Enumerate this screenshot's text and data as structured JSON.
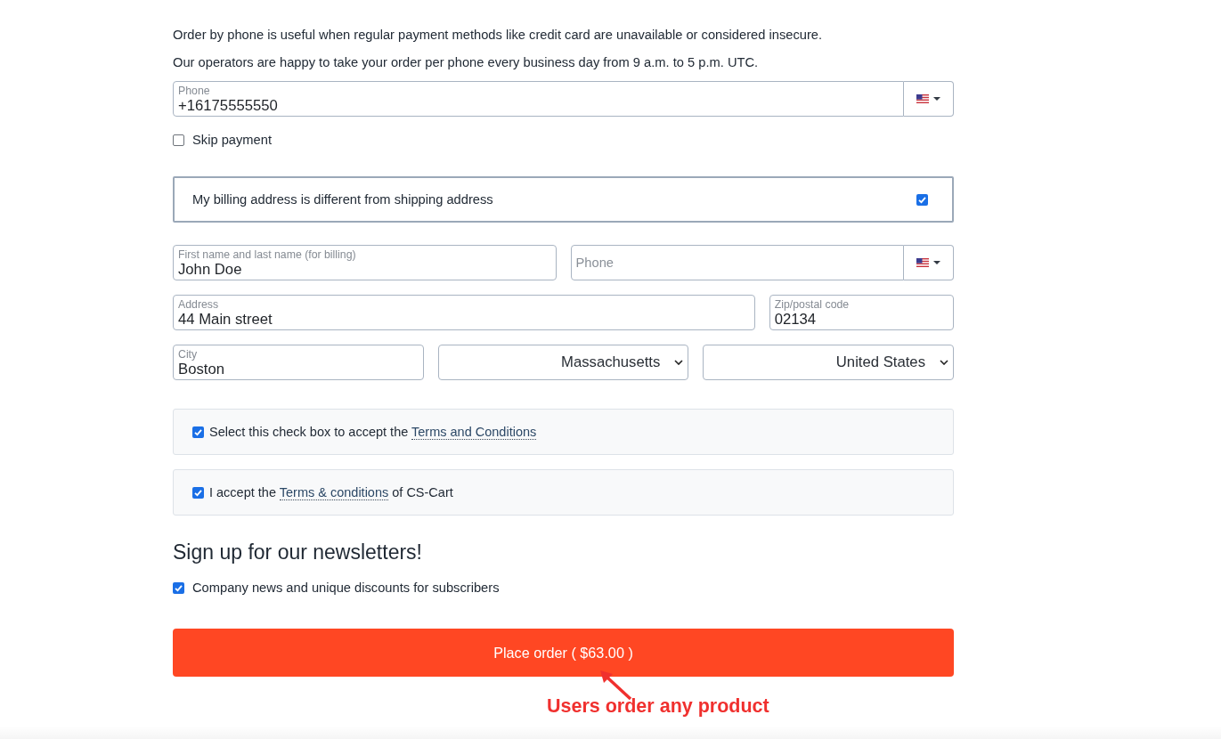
{
  "intro": [
    "Order by phone is useful when regular payment methods like credit card are unavailable or considered insecure.",
    "Our operators are happy to take your order per phone every business day from 9 a.m. to 5 p.m. UTC."
  ],
  "phone": {
    "label": "Phone",
    "value": "+16175555550"
  },
  "skip_payment": {
    "label": "Skip payment",
    "checked": false
  },
  "billing_toggle": {
    "label": "My billing address is different from shipping address",
    "checked": true
  },
  "billing_rows": [
    {
      "fields": [
        {
          "kind": "text",
          "label": "First name and last name (for billing)",
          "value": "John Doe"
        },
        {
          "kind": "phone",
          "placeholder": "Phone"
        }
      ]
    },
    {
      "fields": [
        {
          "kind": "text",
          "label": "Address",
          "value": "44 Main street"
        },
        {
          "kind": "text",
          "label": "Zip/postal code",
          "value": "02134"
        }
      ]
    },
    {
      "fields": [
        {
          "kind": "text",
          "label": "City",
          "value": "Boston"
        },
        {
          "kind": "select",
          "value": "Massachusetts"
        },
        {
          "kind": "select",
          "value": "United States"
        }
      ]
    }
  ],
  "agreements": [
    {
      "before": "Select this check box to accept the ",
      "link": "Terms and Conditions",
      "checked": true
    },
    {
      "before": "I accept the ",
      "link": "Terms & conditions",
      "after": " of CS-Cart",
      "checked": true
    }
  ],
  "newsletters": {
    "heading": "Sign up for our newsletters!",
    "options": [
      {
        "label": "Company news and unique discounts for subscribers",
        "checked": true
      }
    ]
  },
  "place_order_button": {
    "label": "Place order ( $63.00 )"
  },
  "annotation": {
    "text": "Users order any product"
  }
}
